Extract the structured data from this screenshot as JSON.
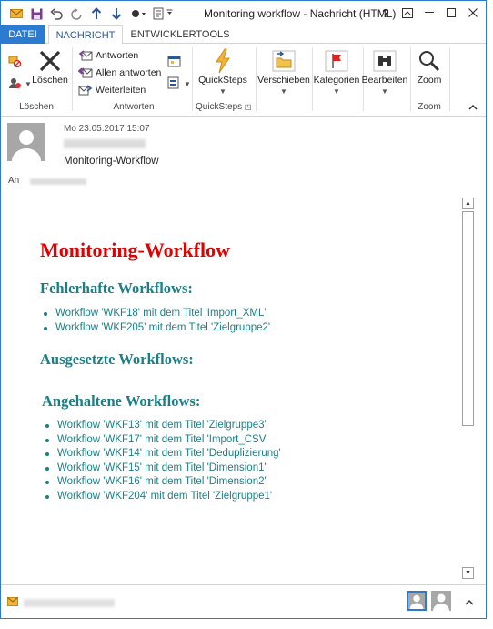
{
  "window": {
    "title": "Monitoring workflow - Nachricht (HTML)",
    "controls": {
      "help": "?",
      "minimize": "—",
      "restore": "⧉",
      "close": "✕"
    }
  },
  "tabs": [
    {
      "label": "DATEI"
    },
    {
      "label": "NACHRICHT"
    },
    {
      "label": "ENTWICKLERTOOLS"
    }
  ],
  "ribbon": {
    "loeschen": {
      "button": "Löschen",
      "group": "Löschen"
    },
    "antworten": {
      "reply": "Antworten",
      "reply_all": "Allen antworten",
      "forward": "Weiterleiten",
      "group": "Antworten"
    },
    "quicksteps": {
      "button": "QuickSteps",
      "group": "QuickSteps"
    },
    "verschieben": {
      "button": "Verschieben"
    },
    "kategorien": {
      "button": "Kategorien"
    },
    "bearbeiten": {
      "button": "Bearbeiten"
    },
    "zoom": {
      "button": "Zoom",
      "group": "Zoom"
    }
  },
  "message": {
    "date": "Mo 23.05.2017 15:07",
    "subject": "Monitoring-Workflow",
    "to_label": "An"
  },
  "body": {
    "heading": "Monitoring-Workflow",
    "sections": [
      {
        "title": "Fehlerhafte Workflows:",
        "items": [
          "Workflow 'WKF18' mit dem Titel 'Import_XML'",
          "Workflow 'WKF205' mit dem Titel 'Zielgruppe2'"
        ]
      },
      {
        "title": "Ausgesetzte Workflows:",
        "items": []
      },
      {
        "title": "Angehaltene Workflows:",
        "items": [
          "Workflow 'WKF13' mit dem Titel 'Zielgruppe3'",
          "Workflow 'WKF17' mit dem Titel 'Import_CSV'",
          "Workflow 'WKF14' mit dem Titel 'Deduplizierung'",
          "Workflow 'WKF15' mit dem Titel 'Dimension1'",
          "Workflow 'WKF16' mit dem Titel 'Dimension2'",
          "Workflow 'WKF204' mit dem Titel 'Zielgruppe1'"
        ]
      }
    ]
  },
  "colors": {
    "accent": "#2b7bd0",
    "heading_red": "#e00000",
    "teal": "#1a7f86"
  }
}
